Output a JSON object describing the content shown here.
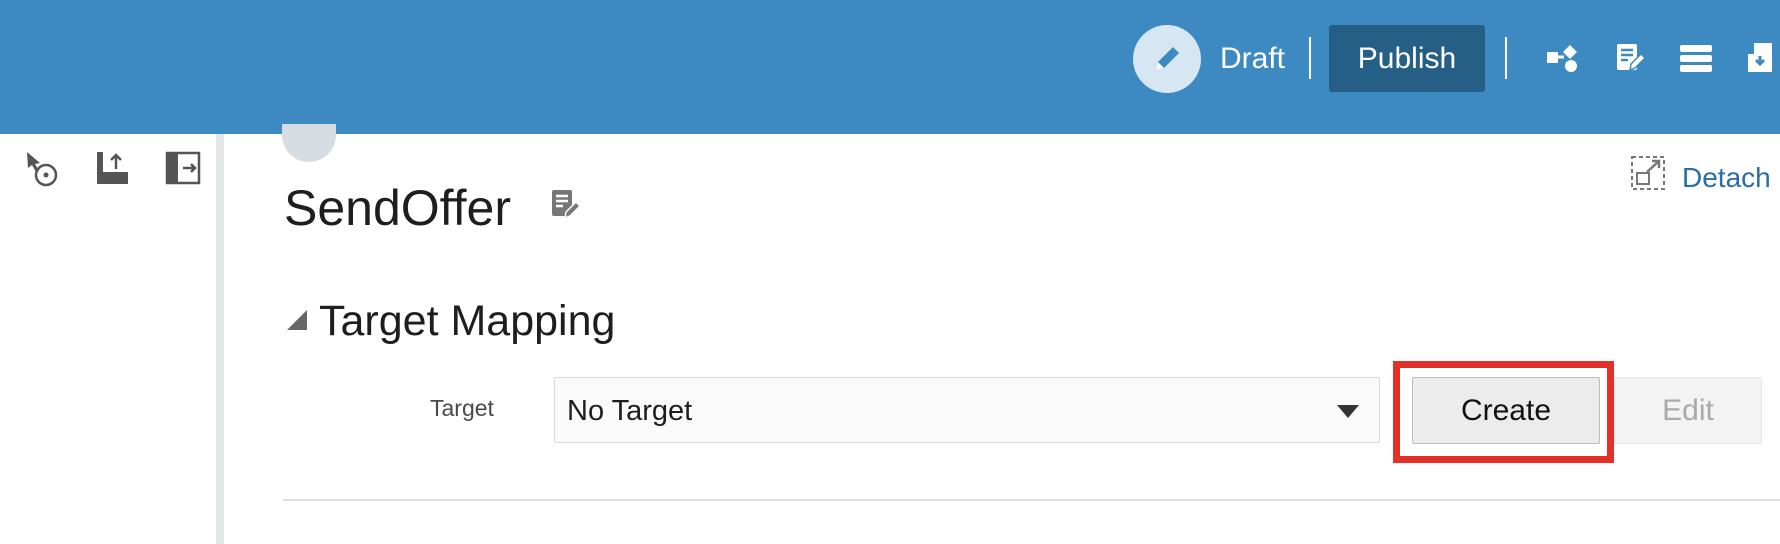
{
  "header": {
    "status_label": "Draft",
    "publish_label": "Publish",
    "icons": [
      "pencil-icon",
      "flow-icon",
      "edit-notes-icon",
      "list-icon",
      "import-icon"
    ]
  },
  "left_toolbar": {
    "icons": [
      "cursor-reset-icon",
      "dock-up-icon",
      "panel-collapse-icon"
    ]
  },
  "main": {
    "title": "SendOffer",
    "detach_label": "Detach",
    "section": {
      "title": "Target Mapping",
      "target_label": "Target",
      "target_value": "No Target",
      "create_label": "Create",
      "edit_label": "Edit"
    }
  },
  "colors": {
    "header_bg": "#3d89c1",
    "publish_bg": "#255f86",
    "highlight": "#e2302a",
    "link": "#2a6ea6"
  }
}
